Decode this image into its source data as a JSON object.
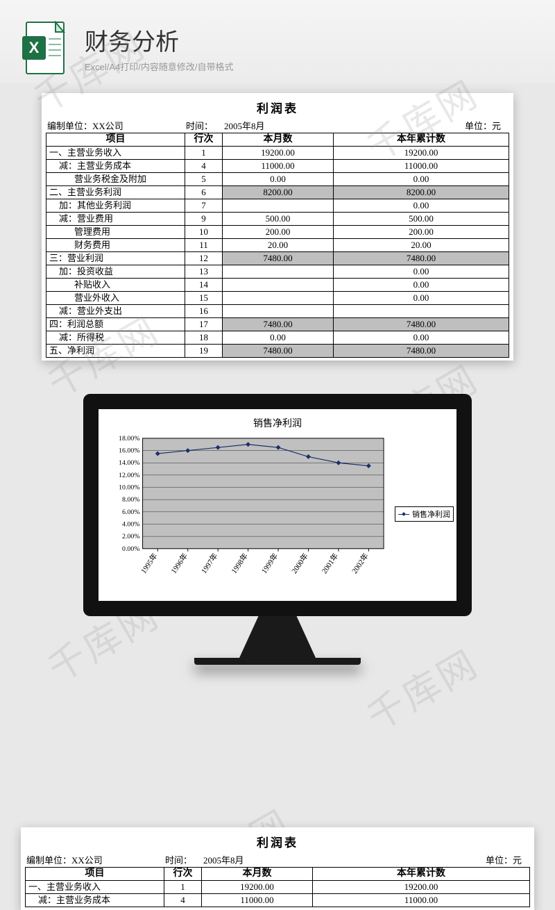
{
  "header": {
    "title": "财务分析",
    "subtitle": "Excel/A4打印/内容随意修改/自带格式"
  },
  "watermark_text": "千库网",
  "sheet": {
    "title": "利润表",
    "meta": {
      "org_label": "编制单位：",
      "org_value": "XX公司",
      "time_label": "时间：",
      "time_value": "2005年8月",
      "unit_label": "单位：",
      "unit_value": "元"
    },
    "columns": {
      "c1": "项目",
      "c2": "行次",
      "c3": "本月数",
      "c4": "本年累计数"
    },
    "rows": [
      {
        "item": "一、主营业务收入",
        "line": "1",
        "month": "19200.00",
        "ytd": "19200.00",
        "indent": 0,
        "shade": false
      },
      {
        "item": "减：主营业务成本",
        "line": "4",
        "month": "11000.00",
        "ytd": "11000.00",
        "indent": 1,
        "shade": false
      },
      {
        "item": "营业务税金及附加",
        "line": "5",
        "month": "0.00",
        "ytd": "0.00",
        "indent": 2,
        "shade": false
      },
      {
        "item": "二、主营业务利润",
        "line": "6",
        "month": "8200.00",
        "ytd": "8200.00",
        "indent": 0,
        "shade": true
      },
      {
        "item": "加：其他业务利润",
        "line": "7",
        "month": "",
        "ytd": "0.00",
        "indent": 1,
        "shade": false
      },
      {
        "item": "减：营业费用",
        "line": "9",
        "month": "500.00",
        "ytd": "500.00",
        "indent": 1,
        "shade": false
      },
      {
        "item": "管理费用",
        "line": "10",
        "month": "200.00",
        "ytd": "200.00",
        "indent": 2,
        "shade": false
      },
      {
        "item": "财务费用",
        "line": "11",
        "month": "20.00",
        "ytd": "20.00",
        "indent": 2,
        "shade": false
      },
      {
        "item": "三：营业利润",
        "line": "12",
        "month": "7480.00",
        "ytd": "7480.00",
        "indent": 0,
        "shade": true
      },
      {
        "item": "加：投资收益",
        "line": "13",
        "month": "",
        "ytd": "0.00",
        "indent": 1,
        "shade": false
      },
      {
        "item": "补贴收入",
        "line": "14",
        "month": "",
        "ytd": "0.00",
        "indent": 2,
        "shade": false
      },
      {
        "item": "营业外收入",
        "line": "15",
        "month": "",
        "ytd": "0.00",
        "indent": 2,
        "shade": false
      },
      {
        "item": "减：营业外支出",
        "line": "16",
        "month": "",
        "ytd": "",
        "indent": 1,
        "shade": false
      },
      {
        "item": "四：利润总额",
        "line": "17",
        "month": "7480.00",
        "ytd": "7480.00",
        "indent": 0,
        "shade": true
      },
      {
        "item": "减：所得税",
        "line": "18",
        "month": "0.00",
        "ytd": "0.00",
        "indent": 1,
        "shade": false
      },
      {
        "item": "五、净利润",
        "line": "19",
        "month": "7480.00",
        "ytd": "7480.00",
        "indent": 0,
        "shade": true
      }
    ]
  },
  "chart_data": {
    "type": "line",
    "title": "销售净利润",
    "xlabel": "",
    "ylabel": "",
    "ylim": [
      0,
      0.18
    ],
    "y_ticks": [
      "0.00%",
      "2.00%",
      "4.00%",
      "6.00%",
      "8.00%",
      "10.00%",
      "12.00%",
      "14.00%",
      "16.00%",
      "18.00%"
    ],
    "categories": [
      "1995年",
      "1996年",
      "1997年",
      "1998年",
      "1999年",
      "2000年",
      "2001年",
      "2002年"
    ],
    "series": [
      {
        "name": "销售净利润",
        "values": [
          0.155,
          0.16,
          0.165,
          0.17,
          0.165,
          0.15,
          0.14,
          0.135
        ]
      }
    ],
    "legend_position": "right"
  }
}
